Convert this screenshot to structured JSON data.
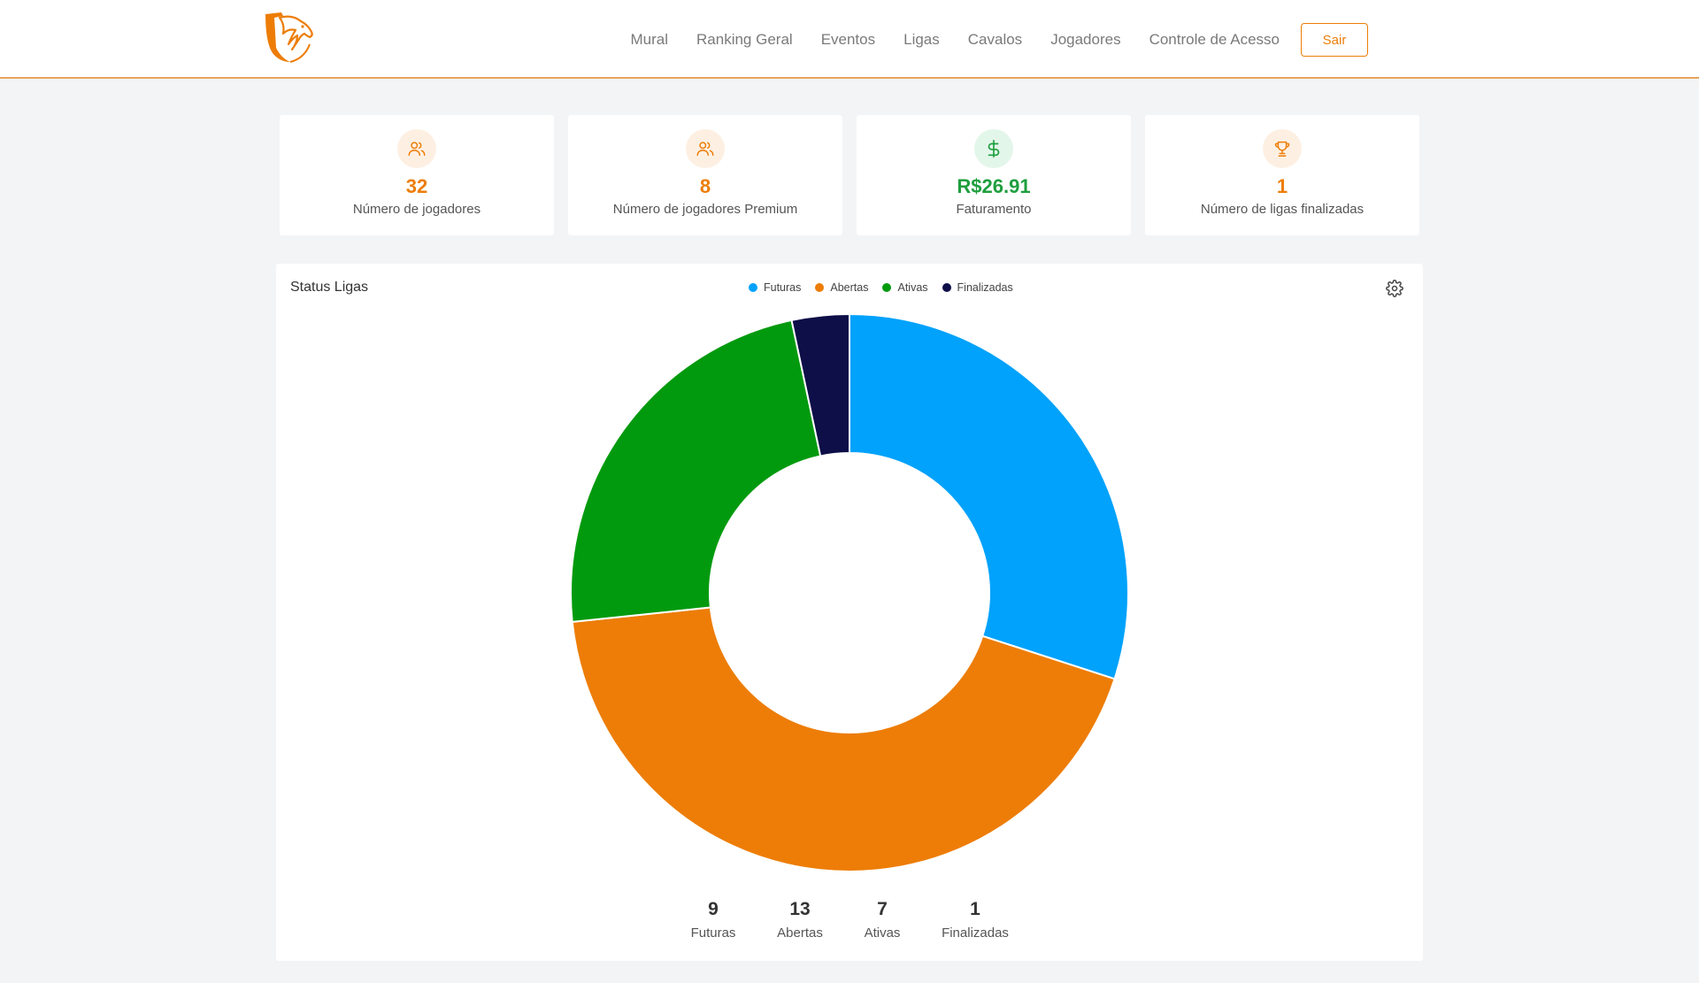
{
  "nav": {
    "items": [
      "Mural",
      "Ranking Geral",
      "Eventos",
      "Ligas",
      "Cavalos",
      "Jogadores",
      "Controle de Acesso"
    ],
    "logout_label": "Sair"
  },
  "stats": [
    {
      "icon": "users-icon",
      "value": "32",
      "label": "Número de jogadores",
      "color": "#ed7d07"
    },
    {
      "icon": "users-icon",
      "value": "8",
      "label": "Número de jogadores Premium",
      "color": "#ed7d07"
    },
    {
      "icon": "dollar-icon",
      "value": "R$26.91",
      "label": "Faturamento",
      "color": "#1e9e3e"
    },
    {
      "icon": "trophy-icon",
      "value": "1",
      "label": "Número de ligas finalizadas",
      "color": "#ed7d07"
    }
  ],
  "chart_data": {
    "type": "pie",
    "variant": "donut",
    "title": "Status Ligas",
    "categories": [
      "Futuras",
      "Abertas",
      "Ativas",
      "Finalizadas"
    ],
    "values": [
      9,
      13,
      7,
      1
    ],
    "colors": [
      "#00a2fb",
      "#ed7d07",
      "#019a0e",
      "#0e0e48"
    ],
    "legend_position": "top-center"
  }
}
